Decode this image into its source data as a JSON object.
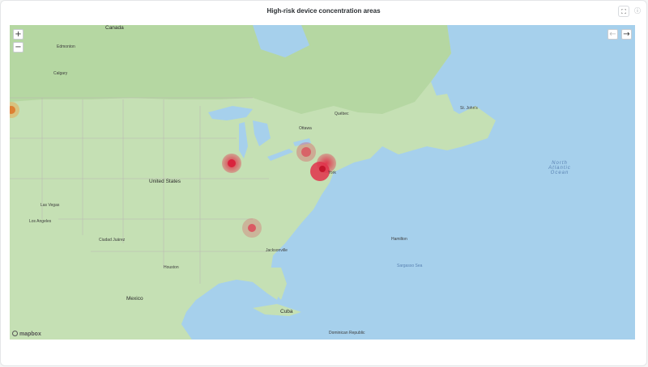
{
  "panel": {
    "title": "High-risk device concentration areas",
    "expand_icon": "expand-icon",
    "info_icon": "info-icon"
  },
  "controls": {
    "zoom_in": "+",
    "zoom_out": "−",
    "prev": "←",
    "next": "→"
  },
  "map": {
    "logo": "mapbox",
    "places": {
      "canada": "Canada",
      "united_states": "United States",
      "mexico": "Mexico",
      "cuba": "Cuba",
      "north_atlantic_ocean": "North Atlantic Ocean",
      "sargasso_sea": "Sargasso Sea",
      "new_york": "York",
      "edmonton": "Edmonton",
      "calgary": "Calgary",
      "las_vegas": "Las Vegas",
      "los_angeles": "Los Angeles",
      "ciudad_juarez": "Ciudad Juárez",
      "st_johns": "St. John's",
      "quebec": "Québec",
      "ottawa": "Ottawa",
      "jacksonville": "Jacksonville",
      "houston": "Houston",
      "hamilton": "Hamilton",
      "dominican_republic": "Dominican Republic"
    },
    "hotspots": [
      {
        "name": "chicago",
        "risk": "high"
      },
      {
        "name": "toronto",
        "risk": "medium"
      },
      {
        "name": "boston",
        "risk": "high"
      },
      {
        "name": "new-york",
        "risk": "high"
      },
      {
        "name": "atlanta",
        "risk": "medium"
      },
      {
        "name": "west-edge",
        "risk": "medium"
      }
    ],
    "colors": {
      "water": "#a6d0ec",
      "land": "#c5e0b4",
      "forest": "#b5d7a2",
      "hotspot": "#e0334b"
    }
  }
}
